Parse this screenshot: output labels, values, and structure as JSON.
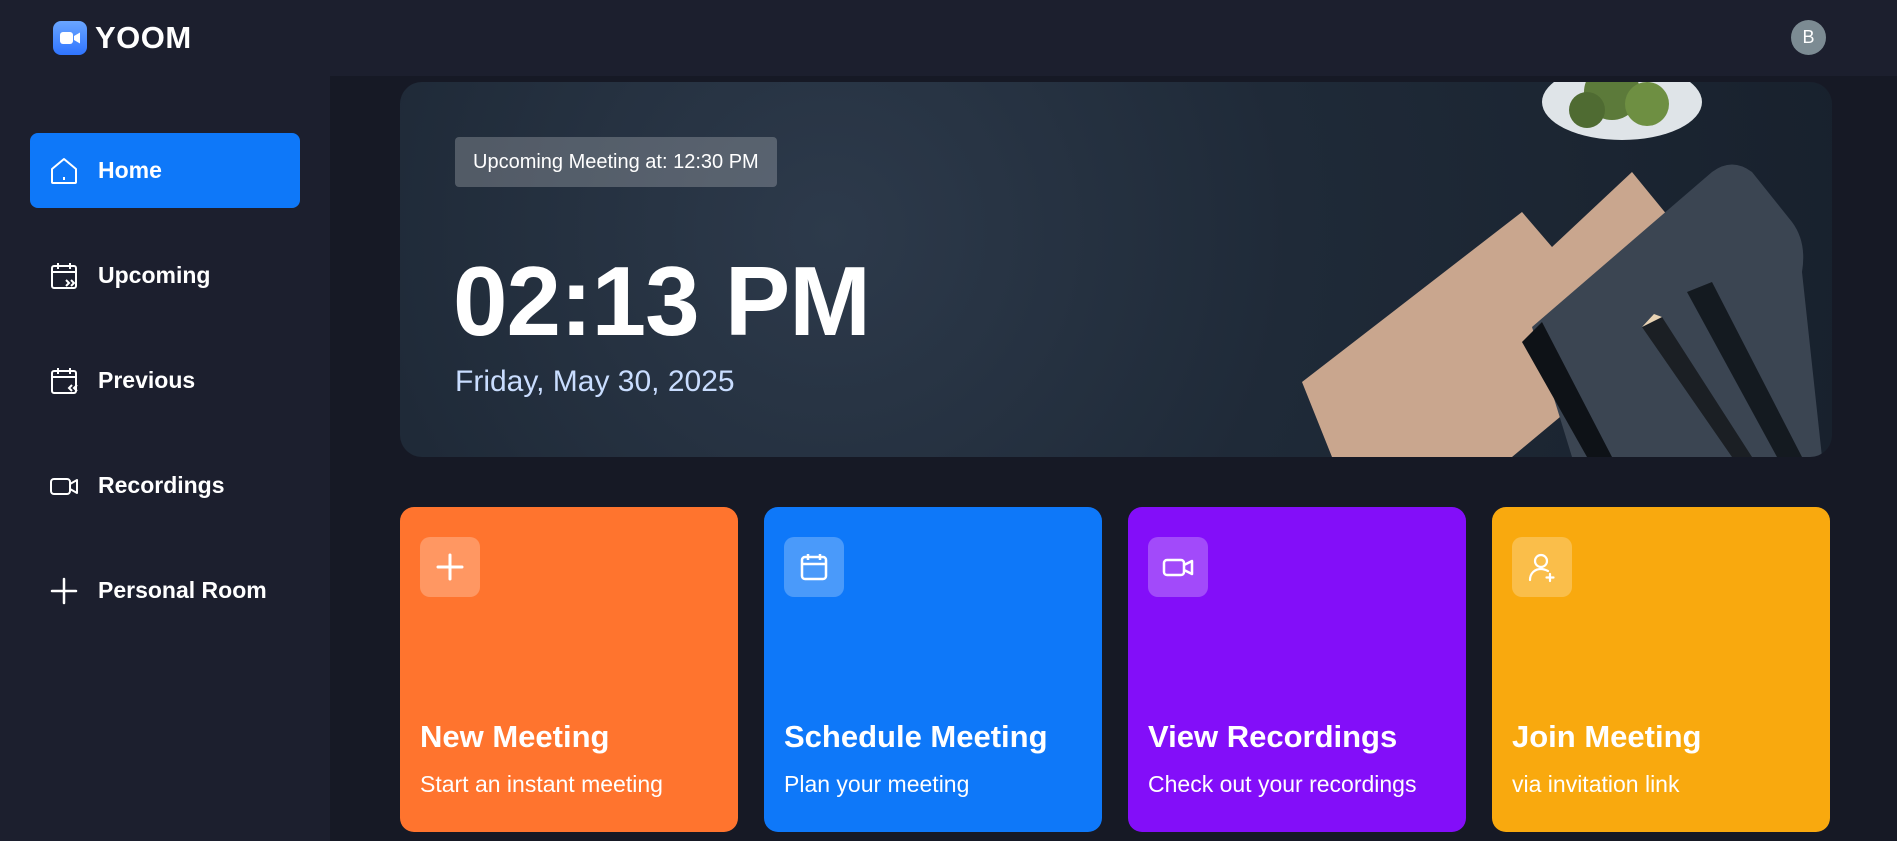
{
  "app": {
    "name": "YOOM",
    "avatar_initial": "B"
  },
  "sidebar": {
    "items": [
      {
        "label": "Home",
        "icon": "home-icon",
        "active": true
      },
      {
        "label": "Upcoming",
        "icon": "calendar-forward-icon",
        "active": false
      },
      {
        "label": "Previous",
        "icon": "calendar-back-icon",
        "active": false
      },
      {
        "label": "Recordings",
        "icon": "video-icon",
        "active": false
      },
      {
        "label": "Personal Room",
        "icon": "plus-icon",
        "active": false
      }
    ]
  },
  "hero": {
    "upcoming": "Upcoming Meeting at: 12:30 PM",
    "time": "02:13 PM",
    "date": "Friday, May 30, 2025"
  },
  "cards": [
    {
      "title": "New Meeting",
      "subtitle": "Start an instant meeting",
      "icon": "plus-icon",
      "color": "#ff742e"
    },
    {
      "title": "Schedule Meeting",
      "subtitle": "Plan your meeting",
      "icon": "calendar-icon",
      "color": "#0e78f9"
    },
    {
      "title": "View Recordings",
      "subtitle": "Check out your recordings",
      "icon": "video-icon",
      "color": "#830ef9"
    },
    {
      "title": "Join Meeting",
      "subtitle": "via invitation link",
      "icon": "add-user-icon",
      "color": "#f9a90e"
    }
  ],
  "colors": {
    "background": "#1c1f2e",
    "accent": "#0e78f9"
  }
}
